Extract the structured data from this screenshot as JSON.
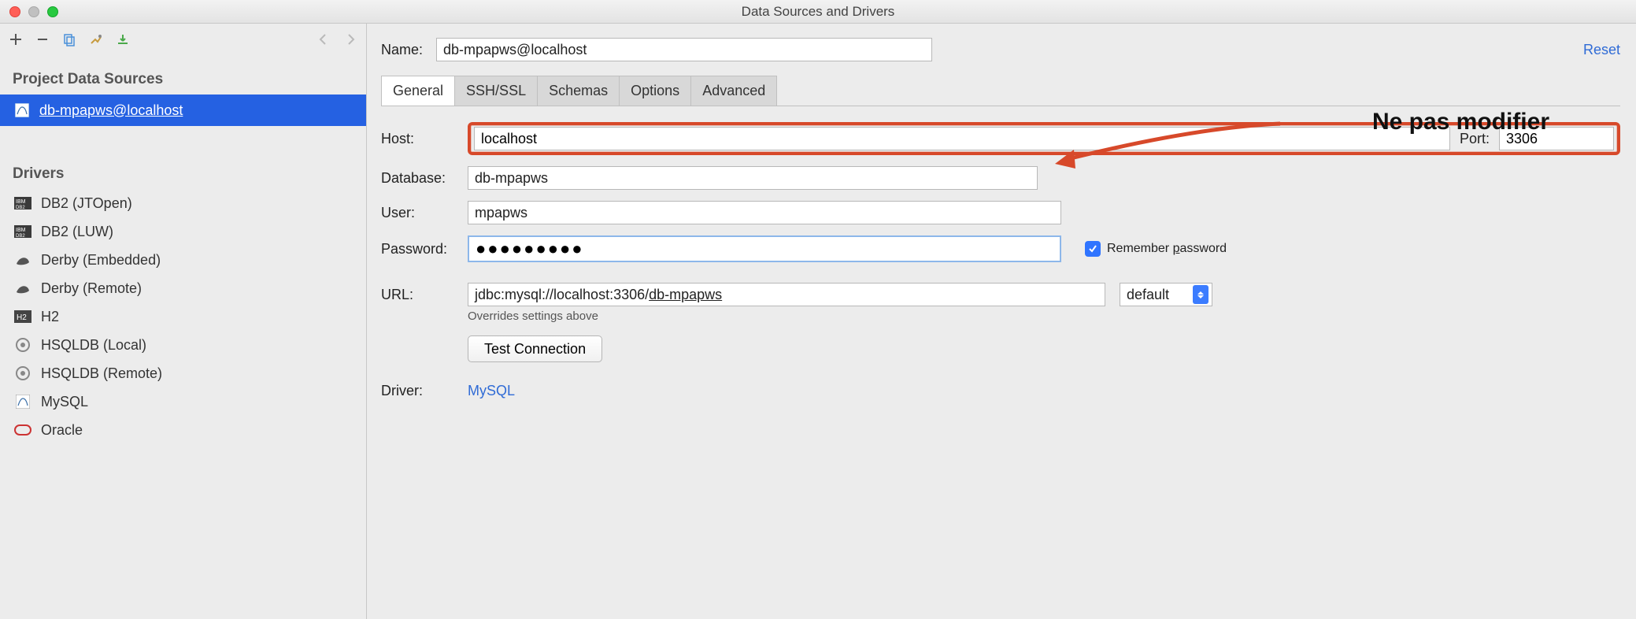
{
  "window": {
    "title": "Data Sources and Drivers"
  },
  "sidebar": {
    "sections": {
      "project": {
        "header": "Project Data Sources",
        "items": [
          {
            "label": "db-mpapws@localhost"
          }
        ]
      },
      "drivers": {
        "header": "Drivers",
        "items": [
          {
            "label": "DB2 (JTOpen)"
          },
          {
            "label": "DB2 (LUW)"
          },
          {
            "label": "Derby (Embedded)"
          },
          {
            "label": "Derby (Remote)"
          },
          {
            "label": "H2"
          },
          {
            "label": "HSQLDB (Local)"
          },
          {
            "label": "HSQLDB (Remote)"
          },
          {
            "label": "MySQL"
          },
          {
            "label": "Oracle"
          }
        ]
      }
    }
  },
  "form": {
    "name_label": "Name:",
    "name_value": "db-mpapws@localhost",
    "reset": "Reset",
    "tabs": [
      "General",
      "SSH/SSL",
      "Schemas",
      "Options",
      "Advanced"
    ],
    "host_label": "Host:",
    "host_value": "localhost",
    "port_label": "Port:",
    "port_value": "3306",
    "db_label": "Database:",
    "db_value": "db-mpapws",
    "user_label": "User:",
    "user_value": "mpapws",
    "pw_label": "Password:",
    "pw_value": "●●●●●●●●●",
    "remember_label": "Remember password",
    "url_label": "URL:",
    "url_prefix": "jdbc:mysql://localhost:3306/",
    "url_suffix": "db-mpapws",
    "url_hint": "Overrides settings above",
    "url_mode": "default",
    "test_btn": "Test Connection",
    "driver_label": "Driver:",
    "driver_value": "MySQL"
  },
  "annotation": {
    "text": "Ne pas modifier"
  }
}
